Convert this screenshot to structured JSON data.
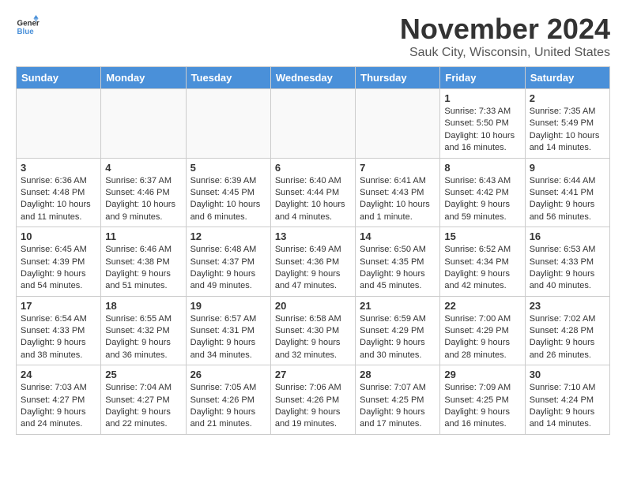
{
  "logo": {
    "general": "General",
    "blue": "Blue"
  },
  "title": "November 2024",
  "subtitle": "Sauk City, Wisconsin, United States",
  "days_of_week": [
    "Sunday",
    "Monday",
    "Tuesday",
    "Wednesday",
    "Thursday",
    "Friday",
    "Saturday"
  ],
  "weeks": [
    [
      {
        "day": "",
        "info": ""
      },
      {
        "day": "",
        "info": ""
      },
      {
        "day": "",
        "info": ""
      },
      {
        "day": "",
        "info": ""
      },
      {
        "day": "",
        "info": ""
      },
      {
        "day": "1",
        "info": "Sunrise: 7:33 AM\nSunset: 5:50 PM\nDaylight: 10 hours and 16 minutes."
      },
      {
        "day": "2",
        "info": "Sunrise: 7:35 AM\nSunset: 5:49 PM\nDaylight: 10 hours and 14 minutes."
      }
    ],
    [
      {
        "day": "3",
        "info": "Sunrise: 6:36 AM\nSunset: 4:48 PM\nDaylight: 10 hours and 11 minutes."
      },
      {
        "day": "4",
        "info": "Sunrise: 6:37 AM\nSunset: 4:46 PM\nDaylight: 10 hours and 9 minutes."
      },
      {
        "day": "5",
        "info": "Sunrise: 6:39 AM\nSunset: 4:45 PM\nDaylight: 10 hours and 6 minutes."
      },
      {
        "day": "6",
        "info": "Sunrise: 6:40 AM\nSunset: 4:44 PM\nDaylight: 10 hours and 4 minutes."
      },
      {
        "day": "7",
        "info": "Sunrise: 6:41 AM\nSunset: 4:43 PM\nDaylight: 10 hours and 1 minute."
      },
      {
        "day": "8",
        "info": "Sunrise: 6:43 AM\nSunset: 4:42 PM\nDaylight: 9 hours and 59 minutes."
      },
      {
        "day": "9",
        "info": "Sunrise: 6:44 AM\nSunset: 4:41 PM\nDaylight: 9 hours and 56 minutes."
      }
    ],
    [
      {
        "day": "10",
        "info": "Sunrise: 6:45 AM\nSunset: 4:39 PM\nDaylight: 9 hours and 54 minutes."
      },
      {
        "day": "11",
        "info": "Sunrise: 6:46 AM\nSunset: 4:38 PM\nDaylight: 9 hours and 51 minutes."
      },
      {
        "day": "12",
        "info": "Sunrise: 6:48 AM\nSunset: 4:37 PM\nDaylight: 9 hours and 49 minutes."
      },
      {
        "day": "13",
        "info": "Sunrise: 6:49 AM\nSunset: 4:36 PM\nDaylight: 9 hours and 47 minutes."
      },
      {
        "day": "14",
        "info": "Sunrise: 6:50 AM\nSunset: 4:35 PM\nDaylight: 9 hours and 45 minutes."
      },
      {
        "day": "15",
        "info": "Sunrise: 6:52 AM\nSunset: 4:34 PM\nDaylight: 9 hours and 42 minutes."
      },
      {
        "day": "16",
        "info": "Sunrise: 6:53 AM\nSunset: 4:33 PM\nDaylight: 9 hours and 40 minutes."
      }
    ],
    [
      {
        "day": "17",
        "info": "Sunrise: 6:54 AM\nSunset: 4:33 PM\nDaylight: 9 hours and 38 minutes."
      },
      {
        "day": "18",
        "info": "Sunrise: 6:55 AM\nSunset: 4:32 PM\nDaylight: 9 hours and 36 minutes."
      },
      {
        "day": "19",
        "info": "Sunrise: 6:57 AM\nSunset: 4:31 PM\nDaylight: 9 hours and 34 minutes."
      },
      {
        "day": "20",
        "info": "Sunrise: 6:58 AM\nSunset: 4:30 PM\nDaylight: 9 hours and 32 minutes."
      },
      {
        "day": "21",
        "info": "Sunrise: 6:59 AM\nSunset: 4:29 PM\nDaylight: 9 hours and 30 minutes."
      },
      {
        "day": "22",
        "info": "Sunrise: 7:00 AM\nSunset: 4:29 PM\nDaylight: 9 hours and 28 minutes."
      },
      {
        "day": "23",
        "info": "Sunrise: 7:02 AM\nSunset: 4:28 PM\nDaylight: 9 hours and 26 minutes."
      }
    ],
    [
      {
        "day": "24",
        "info": "Sunrise: 7:03 AM\nSunset: 4:27 PM\nDaylight: 9 hours and 24 minutes."
      },
      {
        "day": "25",
        "info": "Sunrise: 7:04 AM\nSunset: 4:27 PM\nDaylight: 9 hours and 22 minutes."
      },
      {
        "day": "26",
        "info": "Sunrise: 7:05 AM\nSunset: 4:26 PM\nDaylight: 9 hours and 21 minutes."
      },
      {
        "day": "27",
        "info": "Sunrise: 7:06 AM\nSunset: 4:26 PM\nDaylight: 9 hours and 19 minutes."
      },
      {
        "day": "28",
        "info": "Sunrise: 7:07 AM\nSunset: 4:25 PM\nDaylight: 9 hours and 17 minutes."
      },
      {
        "day": "29",
        "info": "Sunrise: 7:09 AM\nSunset: 4:25 PM\nDaylight: 9 hours and 16 minutes."
      },
      {
        "day": "30",
        "info": "Sunrise: 7:10 AM\nSunset: 4:24 PM\nDaylight: 9 hours and 14 minutes."
      }
    ]
  ]
}
